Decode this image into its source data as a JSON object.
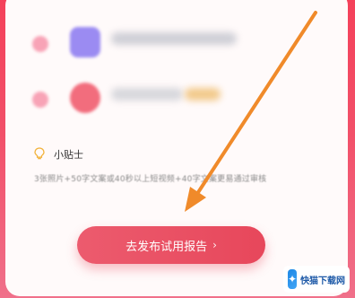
{
  "tip": {
    "title": "小贴士",
    "description": "3张照片+50字文案或40秒以上短视频+40字文案更易通过审核"
  },
  "cta": {
    "label": "去发布试用报告",
    "chevron": "›"
  },
  "watermark": {
    "text": "快猫下载网"
  },
  "colors": {
    "brand": "#e7475b",
    "background": "#f4415a",
    "annotation_arrow": "#f08a2a"
  },
  "icons": [
    "lightbulb-icon",
    "chevron-right-icon"
  ]
}
